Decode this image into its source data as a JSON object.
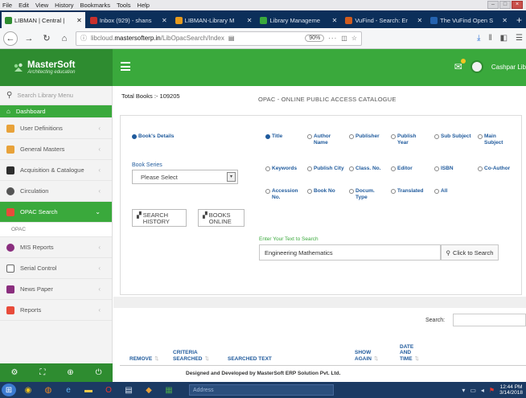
{
  "browser": {
    "menu": [
      "File",
      "Edit",
      "View",
      "History",
      "Bookmarks",
      "Tools",
      "Help"
    ],
    "tabs": [
      {
        "title": "LIBMAN | Central | ",
        "active": true,
        "favicon_color": "#2e8c30"
      },
      {
        "title": "Inbox (929) - shans",
        "active": false,
        "favicon_color": "#c9302c"
      },
      {
        "title": "LIBMAN-Library M",
        "active": false,
        "favicon_color": "#e69b1e"
      },
      {
        "title": "Library Manageme",
        "active": false,
        "favicon_color": "#3aa93c"
      },
      {
        "title": "VuFind - Search: Er",
        "active": false,
        "favicon_color": "#d05c1f"
      },
      {
        "title": "The VuFind Open S",
        "active": false,
        "favicon_color": "#2563b0"
      }
    ],
    "new_tab": "+",
    "url_prefix": "libcloud.",
    "url_host": "mastersofterp.in",
    "url_path": "/LibOpacSearch/Index",
    "zoom": "90%",
    "more": "···"
  },
  "header": {
    "brand_name": "MasterSoft",
    "brand_tagline": "Architecting education",
    "user_name": "Cashpar Lib"
  },
  "sidebar": {
    "search_placeholder": "Search Library Menu",
    "dashboard": "Dashboard",
    "items": [
      {
        "label": "User Definitions",
        "color": "#e8a23a"
      },
      {
        "label": "General Masters",
        "color": "#e8a23a"
      },
      {
        "label": "Acquisition & Catalogue",
        "color": "#2e2e2e"
      },
      {
        "label": "Circulation",
        "color": "#555555"
      },
      {
        "label": "OPAC Search",
        "color": "#e84b3a"
      },
      {
        "label": "MIS Reports",
        "color": "#8a2e7e"
      },
      {
        "label": "Serial Control",
        "color": "#666666"
      },
      {
        "label": "News Paper",
        "color": "#8a2e7e"
      },
      {
        "label": "Reports",
        "color": "#e84b3a"
      }
    ],
    "sub_item": "OPAC"
  },
  "main": {
    "total_books": "Total Books :- 109205",
    "title": "OPAC - ONLINE PUBLIC ACCESS CATALOGUE",
    "books_details": "Book's Details",
    "book_series_label": "Book Series",
    "book_series_value": "Please Select",
    "btn_search_history": "SEARCH HISTORY",
    "btn_books_online": "BOOKS ONLINE",
    "criteria": [
      {
        "label": "Title",
        "checked": true
      },
      {
        "label": "Author Name",
        "checked": false
      },
      {
        "label": "Publisher",
        "checked": false
      },
      {
        "label": "Publish Year",
        "checked": false
      },
      {
        "label": "Sub Subject",
        "checked": false
      },
      {
        "label": "Main Subject",
        "checked": false
      },
      {
        "label": "Keywords",
        "checked": false
      },
      {
        "label": "Publish City",
        "checked": false
      },
      {
        "label": "Class. No.",
        "checked": false
      },
      {
        "label": "Editor",
        "checked": false
      },
      {
        "label": "ISBN",
        "checked": false
      },
      {
        "label": "Co-Author",
        "checked": false
      },
      {
        "label": "Accession No.",
        "checked": false
      },
      {
        "label": "Book No",
        "checked": false
      },
      {
        "label": "Docum. Type",
        "checked": false
      },
      {
        "label": "Translated",
        "checked": false
      },
      {
        "label": "All",
        "checked": false
      }
    ],
    "enter_text_label": "Enter Your Text to Search",
    "search_value": "Engineering Mathematics",
    "search_button": "Click to Search",
    "table_search_label": "Search:",
    "columns": [
      "REMOVE",
      "CRITERIA SEARCHED",
      "SEARCHED TEXT",
      "SHOW AGAIN",
      "DATE AND TIME"
    ],
    "credit": "Designed and Developed by MasterSoft ERP Solution Pvt. Ltd."
  },
  "taskbar": {
    "address_label": "Address",
    "time": "12:44 PM",
    "date": "3/14/2018"
  }
}
